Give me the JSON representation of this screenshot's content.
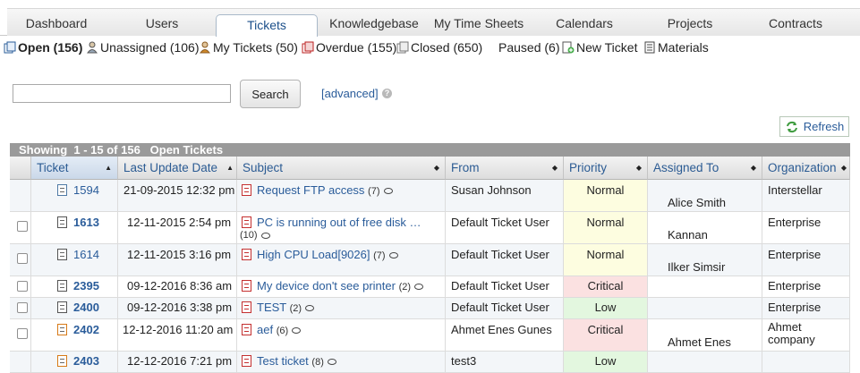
{
  "nav": {
    "tabs": [
      {
        "label": "Dashboard"
      },
      {
        "label": "Users"
      },
      {
        "label": "Tickets"
      },
      {
        "label": "Knowledgebase"
      },
      {
        "label": "My Time Sheets"
      },
      {
        "label": "Calendars"
      },
      {
        "label": "Projects"
      },
      {
        "label": "Contracts"
      }
    ],
    "active_tab": "Tickets"
  },
  "subnav": {
    "items": [
      {
        "label": "Open (156)",
        "icon": "open-tickets-icon"
      },
      {
        "label": "Unassigned (106)",
        "icon": "unassigned-user-icon"
      },
      {
        "label": "My Tickets (50)",
        "icon": "my-tickets-user-icon"
      },
      {
        "label": "Overdue (155)",
        "icon": "overdue-icon"
      },
      {
        "label": "Closed (650)",
        "icon": "closed-tickets-icon"
      },
      {
        "label": "Paused (6)",
        "icon": ""
      },
      {
        "label": "New Ticket",
        "icon": "new-ticket-icon"
      },
      {
        "label": "Materials",
        "icon": "materials-icon"
      }
    ]
  },
  "search": {
    "value": "",
    "button_label": "Search",
    "advanced_label": "[advanced]"
  },
  "refresh_label": "Refresh",
  "table": {
    "showing_text": "Showing  1 - 15 of 156   Open Tickets",
    "columns": [
      "Ticket",
      "Last Update Date",
      "Subject",
      "From",
      "Priority",
      "Assigned To",
      "Organization"
    ],
    "sorted_column": "Ticket",
    "rows": [
      {
        "ticket": "1594",
        "updated": "21-09-2015 12:32 pm",
        "subject": "Request FTP access",
        "count": "(7)",
        "from": "Susan Johnson",
        "priority": "Normal",
        "assigned": "Alice Smith",
        "org": "Interstellar"
      },
      {
        "ticket": "1613",
        "updated": "12-11-2015 2:54 pm",
        "subject": "PC is running out of free disk …",
        "count": "(10)",
        "from": "Default Ticket User",
        "priority": "Normal",
        "assigned": "Kannan",
        "org": "Enterprise"
      },
      {
        "ticket": "1614",
        "updated": "12-11-2015 3:16 pm",
        "subject": "High CPU Load[9026]",
        "count": "(7)",
        "from": "Default Ticket User",
        "priority": "Normal",
        "assigned": "Ilker Simsir",
        "org": "Enterprise"
      },
      {
        "ticket": "2395",
        "updated": "09-12-2016 8:36 am",
        "subject": "My device don't see printer",
        "count": "(2)",
        "from": "Default Ticket User",
        "priority": "Critical",
        "assigned": "",
        "org": "Enterprise"
      },
      {
        "ticket": "2400",
        "updated": "09-12-2016 3:38 pm",
        "subject": "TEST",
        "count": "(2)",
        "from": "Default Ticket User",
        "priority": "Low",
        "assigned": "",
        "org": "Enterprise"
      },
      {
        "ticket": "2402",
        "updated": "12-12-2016 11:20 am",
        "subject": "aef",
        "count": "(6)",
        "from": "Ahmet Enes Gunes",
        "priority": "Critical",
        "assigned": "Ahmet Enes",
        "org": "Ahmet company"
      },
      {
        "ticket": "2403",
        "updated": "12-12-2016 7:21 pm",
        "subject": "Test ticket",
        "count": "(8)",
        "from": "test3",
        "priority": "Low",
        "assigned": "",
        "org": ""
      }
    ]
  },
  "colors": {
    "link": "#2a5c9a",
    "priority_normal": "#fdfde0",
    "priority_critical": "#fbe1e1",
    "priority_low": "#e3f7df"
  }
}
